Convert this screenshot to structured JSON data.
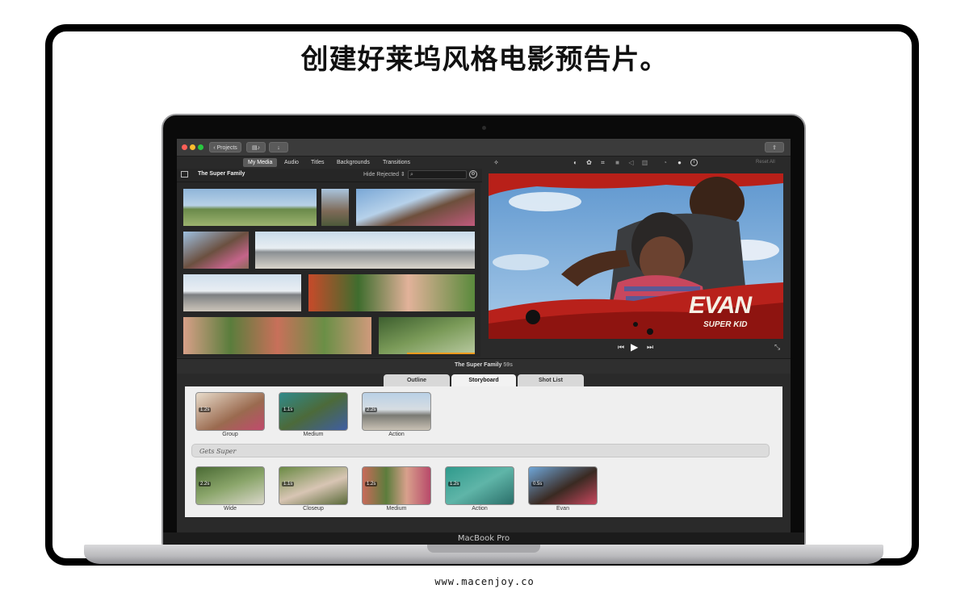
{
  "headline": "创建好莱坞风格电影预告片。",
  "footer_url": "www.macenjoy.co",
  "laptop": {
    "brand": "MacBook Pro"
  },
  "app": {
    "toolbar": {
      "projects_label": "Projects",
      "share_icon": "share-icon",
      "import_icon": "import-arrow-icon"
    },
    "media_tabs": [
      "My Media",
      "Audio",
      "Titles",
      "Backgrounds",
      "Transitions"
    ],
    "active_media_tab": "My Media",
    "library_title": "The Super Family",
    "filter_label": "Hide Rejected",
    "reset_all": "Reset All",
    "viewer": {
      "title_big": "EVAN",
      "title_small": "SUPER KID"
    },
    "project_bar": {
      "title": "The Super Family",
      "duration": "59s"
    },
    "trailer_tabs": [
      "Outline",
      "Storyboard",
      "Shot List"
    ],
    "active_trailer_tab": "Storyboard",
    "section_title": "Gets Super",
    "row1": [
      {
        "duration": "1.2s",
        "label": "Group"
      },
      {
        "duration": "1.1s",
        "label": "Medium"
      },
      {
        "duration": "2.2s",
        "label": "Action"
      }
    ],
    "row2": [
      {
        "duration": "2.2s",
        "label": "Wide"
      },
      {
        "duration": "1.1s",
        "label": "Closeup"
      },
      {
        "duration": "1.2s",
        "label": "Medium"
      },
      {
        "duration": "1.2s",
        "label": "Action"
      },
      {
        "duration": "0.5s",
        "label": "Evan"
      }
    ]
  },
  "colors": {
    "accent_red": "#c2271f",
    "sky": "#6fa6d8",
    "ui_dark": "#2a2a2a",
    "storyboard_bg": "#efefef"
  }
}
